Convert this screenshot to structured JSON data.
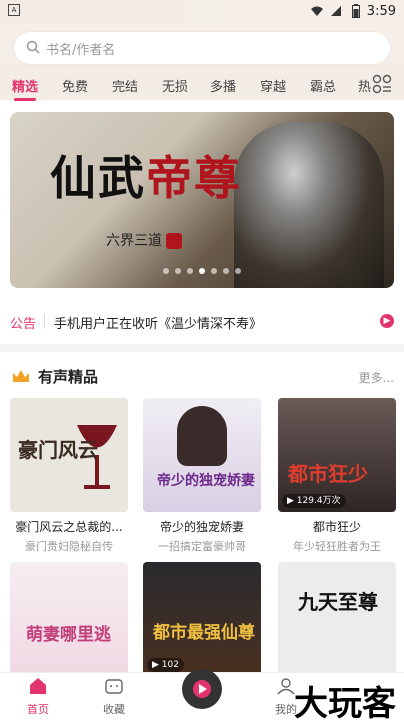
{
  "status_bar": {
    "time": "3:59",
    "indicator": "A"
  },
  "search": {
    "placeholder": "书名/作者名"
  },
  "tabs": [
    "精选",
    "免费",
    "完结",
    "无损",
    "多播",
    "穿越",
    "霸总",
    "热"
  ],
  "banner": {
    "title_a": "仙武",
    "title_b": "帝尊",
    "author": "六界三道"
  },
  "notice": {
    "label": "公告",
    "text": "手机用户正在收听《温少情深不寿》"
  },
  "section": {
    "title": "有声精品",
    "more": "更多"
  },
  "books": [
    {
      "cover_text": "豪门风云",
      "title": "豪门风云之总裁的...",
      "subtitle": "豪门贵妇隐秘自传",
      "cover_color": "#e9e5df",
      "text_color": "#3a2a20"
    },
    {
      "cover_text": "帝少的独宠娇妻",
      "title": "帝少的独宠娇妻",
      "subtitle": "一招搞定富豪帅哥",
      "cover_color": "#f1eef4",
      "text_color": "#6d2a8a"
    },
    {
      "cover_text": "都市狂少",
      "title": "都市狂少",
      "subtitle": "年少轻狂胜者为王",
      "cover_color": "#4a3a39",
      "text_color": "#e03c2f",
      "plays": "129.4万次"
    },
    {
      "cover_text": "萌妻哪里逃",
      "title": "",
      "subtitle": "",
      "cover_color": "#f5eef2",
      "text_color": "#c33f7a"
    },
    {
      "cover_text": "都市最强仙尊",
      "title": "",
      "subtitle": "",
      "cover_color": "#2a2a2e",
      "text_color": "#f0c040",
      "plays": "102"
    },
    {
      "cover_text": "九天至尊",
      "title": "",
      "subtitle": "",
      "cover_color": "#ececec",
      "text_color": "#111111"
    }
  ],
  "bottom_nav": [
    {
      "label": "首页",
      "icon": "home-icon"
    },
    {
      "label": "收藏",
      "icon": "favorite-icon"
    },
    {
      "label": "",
      "icon": "player-icon"
    },
    {
      "label": "我的",
      "icon": "profile-icon"
    }
  ],
  "watermark": "大玩客",
  "colors": {
    "accent": "#e2356d",
    "header_bg": "#f4ede8"
  }
}
